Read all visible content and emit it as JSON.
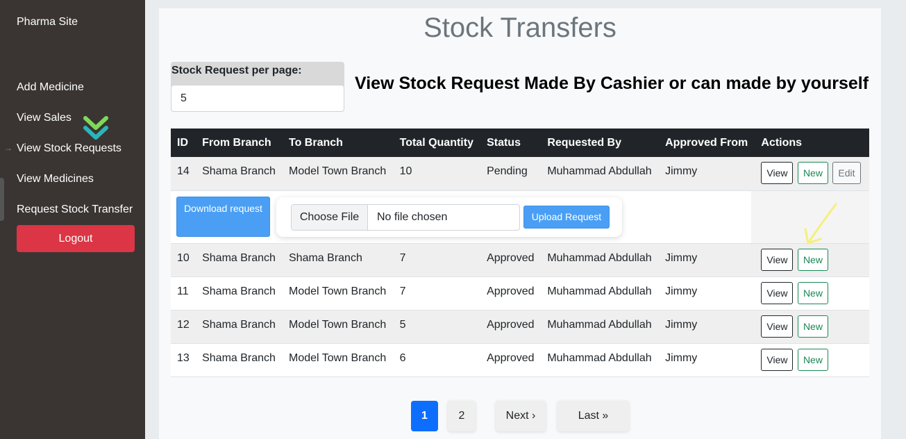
{
  "sidebar": {
    "brand": "Pharma Site",
    "items": [
      {
        "label": "Add Medicine"
      },
      {
        "label": "View Sales"
      },
      {
        "label": "View Stock Requests",
        "active_marker": "→"
      },
      {
        "label": "View Medicines"
      },
      {
        "label": "Request Stock Transfer"
      }
    ],
    "logout": "Logout"
  },
  "page": {
    "title": "Stock Transfers",
    "per_page_label": "Stock Request per page:",
    "per_page_value": "5",
    "heading": "View Stock Request Made By Cashier or can made by yourself"
  },
  "table": {
    "headers": [
      "ID",
      "From Branch",
      "To Branch",
      "Total Quantity",
      "Status",
      "Requested By",
      "Approved From",
      "Actions"
    ],
    "rows": [
      {
        "id": "14",
        "from": "Shama Branch",
        "to": "Model Town Branch",
        "qty": "10",
        "status": "Pending",
        "requested_by": "Muhammad Abdullah",
        "approved_from": "Jimmy"
      },
      {
        "id": "10",
        "from": "Shama Branch",
        "to": "Shama Branch",
        "qty": "7",
        "status": "Approved",
        "requested_by": "Muhammad Abdullah",
        "approved_from": "Jimmy"
      },
      {
        "id": "11",
        "from": "Shama Branch",
        "to": "Model Town Branch",
        "qty": "7",
        "status": "Approved",
        "requested_by": "Muhammad Abdullah",
        "approved_from": "Jimmy"
      },
      {
        "id": "12",
        "from": "Shama Branch",
        "to": "Model Town Branch",
        "qty": "5",
        "status": "Approved",
        "requested_by": "Muhammad Abdullah",
        "approved_from": "Jimmy"
      },
      {
        "id": "13",
        "from": "Shama Branch",
        "to": "Model Town Branch",
        "qty": "6",
        "status": "Approved",
        "requested_by": "Muhammad Abdullah",
        "approved_from": "Jimmy"
      }
    ],
    "actions": {
      "view": "View",
      "new": "New",
      "edit": "Edit"
    }
  },
  "upload": {
    "download_label": "Download request",
    "choose_file": "Choose File",
    "no_file": "No file chosen",
    "upload_label": "Upload Request"
  },
  "pagination": {
    "pages": [
      "1",
      "2"
    ],
    "current": "1",
    "next": "Next ›",
    "last": "Last »"
  },
  "colors": {
    "accent": "#0d6efd",
    "danger": "#dc3545",
    "success": "#198754",
    "sidebar": "#3a3533"
  }
}
